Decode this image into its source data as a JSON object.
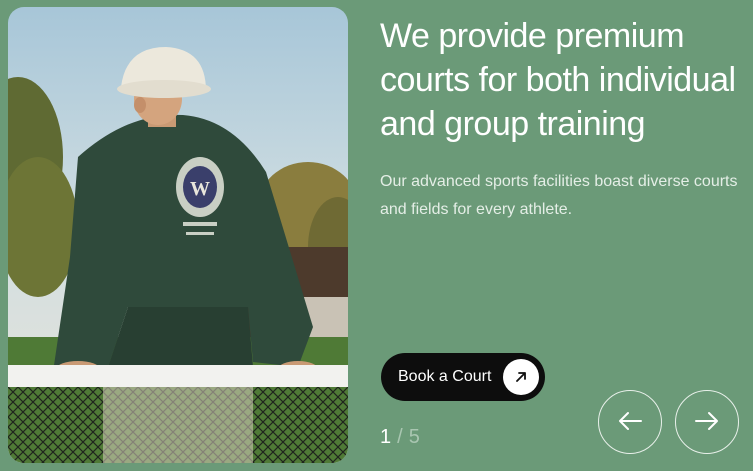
{
  "hero": {
    "headline": "We provide premium courts for both individual and group training",
    "subtext": "Our advanced sports facilities boast diverse courts and fields for every athlete.",
    "cta_label": "Book a Court",
    "cta_icon": "arrow-up-right-icon",
    "image_description": "tennis player in green jacket leaning on net"
  },
  "slider": {
    "current": "1",
    "separator": "/",
    "total": "5",
    "prev_icon": "arrow-left-icon",
    "next_icon": "arrow-right-icon"
  },
  "colors": {
    "background": "#6b9a78",
    "button": "#0d0d0d",
    "text": "#ffffff"
  }
}
